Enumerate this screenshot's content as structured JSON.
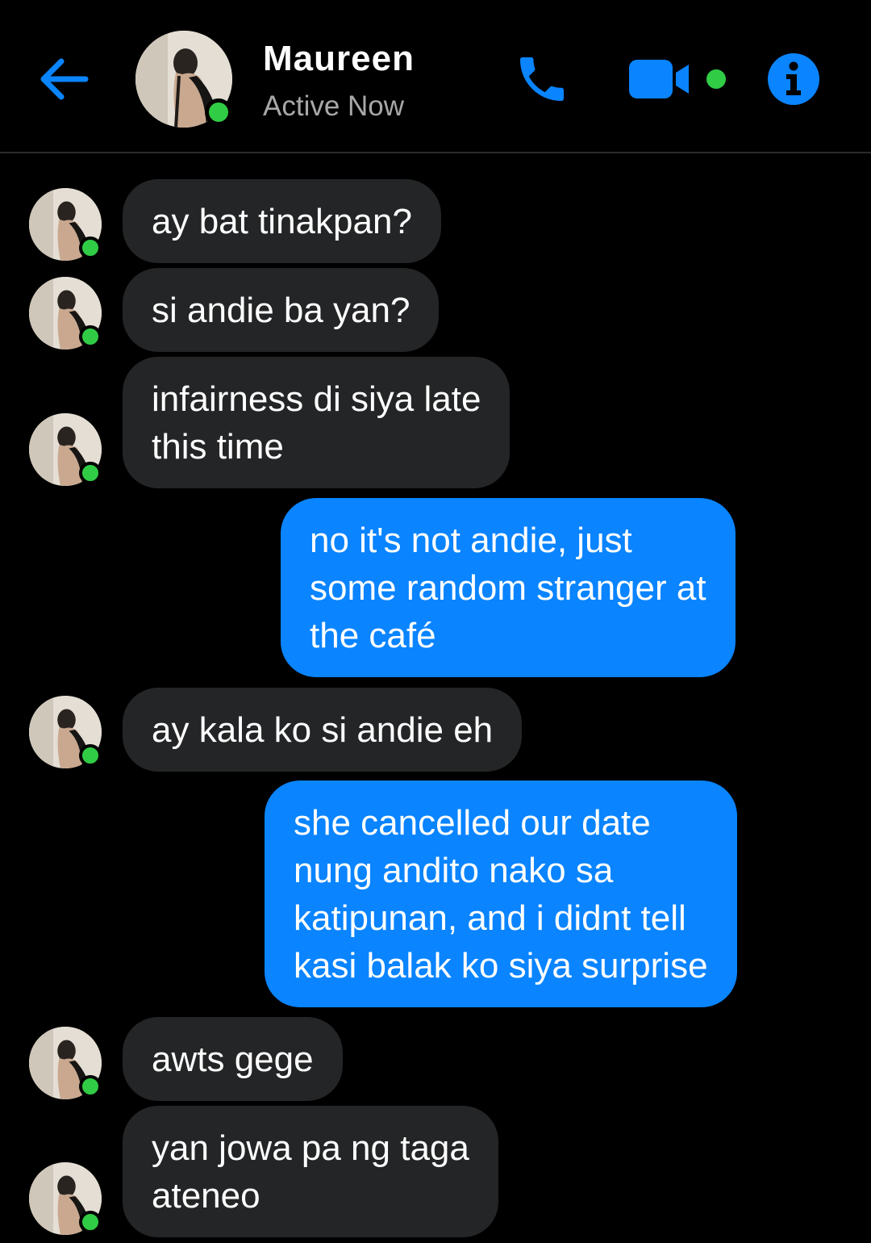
{
  "header": {
    "contact_name": "Maureen",
    "status": "Active Now",
    "back_icon": "arrow-left-icon",
    "call_icon": "phone-icon",
    "video_icon": "video-camera-icon",
    "info_icon": "info-icon",
    "accent_color": "#0a84ff",
    "online_color": "#31cc46"
  },
  "messages": [
    {
      "from": "Maureen",
      "text": "ay bat tinakpan?"
    },
    {
      "from": "Maureen",
      "text": "si andie ba yan?"
    },
    {
      "from": "Maureen",
      "text": "infairness di siya late\nthis time"
    },
    {
      "from": "me",
      "text": "no it's not andie, just\nsome random stranger at\nthe café"
    },
    {
      "from": "Maureen",
      "text": "ay kala ko si andie eh"
    },
    {
      "from": "me",
      "text": "she cancelled our date\nnung andito nako sa\nkatipunan, and i didnt tell\nkasi balak ko siya surprise"
    },
    {
      "from": "Maureen",
      "text": "awts gege"
    },
    {
      "from": "Maureen",
      "text": "yan jowa pa ng taga\nateneo"
    }
  ],
  "colors": {
    "incoming_bubble": "#242526",
    "outgoing_bubble": "#0a84ff",
    "background": "#000000"
  }
}
